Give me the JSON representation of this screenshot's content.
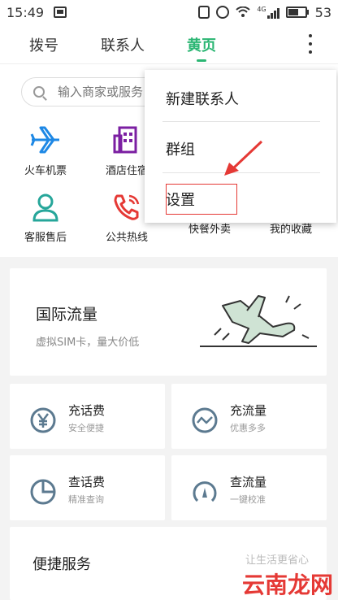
{
  "status_bar": {
    "time": "15:49",
    "network": "4G",
    "battery": "53"
  },
  "tabs": [
    {
      "label": "拨号",
      "active": false
    },
    {
      "label": "联系人",
      "active": false
    },
    {
      "label": "黄页",
      "active": true
    }
  ],
  "search": {
    "placeholder": "输入商家或服务"
  },
  "services": [
    {
      "label": "火车机票",
      "icon": "airplane-icon"
    },
    {
      "label": "酒店住宿",
      "icon": "hotel-icon"
    },
    {
      "label": "客服售后",
      "icon": "person-icon"
    },
    {
      "label": "公共热线",
      "icon": "phone-icon"
    },
    {
      "label": "快餐外卖",
      "icon": "food-icon"
    },
    {
      "label": "我的收藏",
      "icon": "star-icon"
    }
  ],
  "intl_card": {
    "title": "国际流量",
    "subtitle": "虚拟SIM卡，量大价低"
  },
  "cards": [
    {
      "title": "充话费",
      "subtitle": "安全便捷",
      "icon": "yen-icon"
    },
    {
      "title": "充流量",
      "subtitle": "优惠多多",
      "icon": "wave-icon"
    },
    {
      "title": "查话费",
      "subtitle": "精准查询",
      "icon": "pie-icon"
    },
    {
      "title": "查流量",
      "subtitle": "一键校准",
      "icon": "gauge-icon"
    }
  ],
  "bottom_card": {
    "title": "便捷服务",
    "subtitle": "让生活更省心"
  },
  "menu": {
    "items": [
      "新建联系人",
      "群组",
      "设置"
    ]
  },
  "watermark": "云南龙网",
  "colors": {
    "accent": "#2bb673",
    "blue": "#1e88e5",
    "purple": "#7b1fa2",
    "teal": "#26a69a",
    "red": "#e53935",
    "icon_gray": "#5c7a90"
  }
}
